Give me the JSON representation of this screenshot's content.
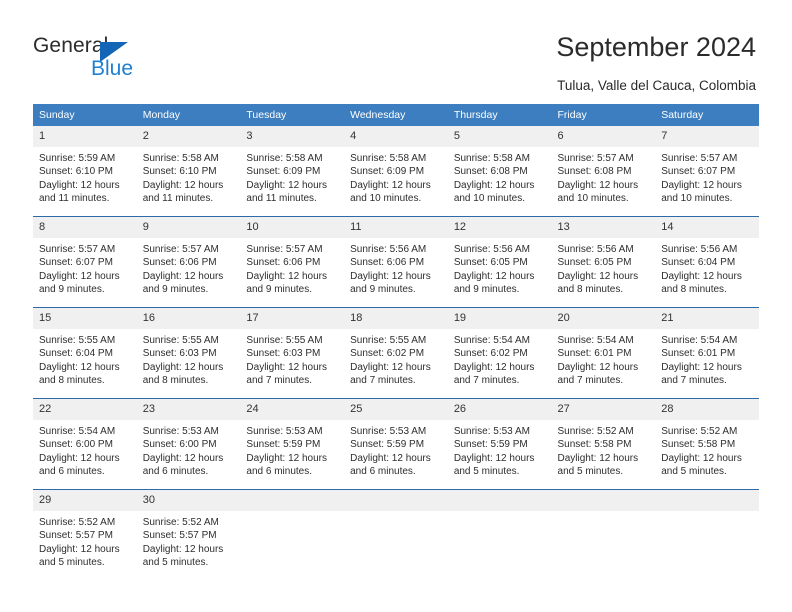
{
  "brand": {
    "name_top": "General",
    "name_bottom": "Blue",
    "accent_color": "#1f7fd0",
    "triangle_color": "#1266b5"
  },
  "header": {
    "title": "September 2024",
    "subtitle": "Tulua, Valle del Cauca, Colombia"
  },
  "calendar": {
    "header_bg": "#3c7ebf",
    "row_border_color": "#2c6ba5",
    "daynum_bg": "#f0f0f0",
    "weekdays": [
      "Sunday",
      "Monday",
      "Tuesday",
      "Wednesday",
      "Thursday",
      "Friday",
      "Saturday"
    ],
    "weeks": [
      [
        {
          "day": "1",
          "sunrise": "Sunrise: 5:59 AM",
          "sunset": "Sunset: 6:10 PM",
          "daylight1": "Daylight: 12 hours",
          "daylight2": "and 11 minutes."
        },
        {
          "day": "2",
          "sunrise": "Sunrise: 5:58 AM",
          "sunset": "Sunset: 6:10 PM",
          "daylight1": "Daylight: 12 hours",
          "daylight2": "and 11 minutes."
        },
        {
          "day": "3",
          "sunrise": "Sunrise: 5:58 AM",
          "sunset": "Sunset: 6:09 PM",
          "daylight1": "Daylight: 12 hours",
          "daylight2": "and 11 minutes."
        },
        {
          "day": "4",
          "sunrise": "Sunrise: 5:58 AM",
          "sunset": "Sunset: 6:09 PM",
          "daylight1": "Daylight: 12 hours",
          "daylight2": "and 10 minutes."
        },
        {
          "day": "5",
          "sunrise": "Sunrise: 5:58 AM",
          "sunset": "Sunset: 6:08 PM",
          "daylight1": "Daylight: 12 hours",
          "daylight2": "and 10 minutes."
        },
        {
          "day": "6",
          "sunrise": "Sunrise: 5:57 AM",
          "sunset": "Sunset: 6:08 PM",
          "daylight1": "Daylight: 12 hours",
          "daylight2": "and 10 minutes."
        },
        {
          "day": "7",
          "sunrise": "Sunrise: 5:57 AM",
          "sunset": "Sunset: 6:07 PM",
          "daylight1": "Daylight: 12 hours",
          "daylight2": "and 10 minutes."
        }
      ],
      [
        {
          "day": "8",
          "sunrise": "Sunrise: 5:57 AM",
          "sunset": "Sunset: 6:07 PM",
          "daylight1": "Daylight: 12 hours",
          "daylight2": "and 9 minutes."
        },
        {
          "day": "9",
          "sunrise": "Sunrise: 5:57 AM",
          "sunset": "Sunset: 6:06 PM",
          "daylight1": "Daylight: 12 hours",
          "daylight2": "and 9 minutes."
        },
        {
          "day": "10",
          "sunrise": "Sunrise: 5:57 AM",
          "sunset": "Sunset: 6:06 PM",
          "daylight1": "Daylight: 12 hours",
          "daylight2": "and 9 minutes."
        },
        {
          "day": "11",
          "sunrise": "Sunrise: 5:56 AM",
          "sunset": "Sunset: 6:06 PM",
          "daylight1": "Daylight: 12 hours",
          "daylight2": "and 9 minutes."
        },
        {
          "day": "12",
          "sunrise": "Sunrise: 5:56 AM",
          "sunset": "Sunset: 6:05 PM",
          "daylight1": "Daylight: 12 hours",
          "daylight2": "and 9 minutes."
        },
        {
          "day": "13",
          "sunrise": "Sunrise: 5:56 AM",
          "sunset": "Sunset: 6:05 PM",
          "daylight1": "Daylight: 12 hours",
          "daylight2": "and 8 minutes."
        },
        {
          "day": "14",
          "sunrise": "Sunrise: 5:56 AM",
          "sunset": "Sunset: 6:04 PM",
          "daylight1": "Daylight: 12 hours",
          "daylight2": "and 8 minutes."
        }
      ],
      [
        {
          "day": "15",
          "sunrise": "Sunrise: 5:55 AM",
          "sunset": "Sunset: 6:04 PM",
          "daylight1": "Daylight: 12 hours",
          "daylight2": "and 8 minutes."
        },
        {
          "day": "16",
          "sunrise": "Sunrise: 5:55 AM",
          "sunset": "Sunset: 6:03 PM",
          "daylight1": "Daylight: 12 hours",
          "daylight2": "and 8 minutes."
        },
        {
          "day": "17",
          "sunrise": "Sunrise: 5:55 AM",
          "sunset": "Sunset: 6:03 PM",
          "daylight1": "Daylight: 12 hours",
          "daylight2": "and 7 minutes."
        },
        {
          "day": "18",
          "sunrise": "Sunrise: 5:55 AM",
          "sunset": "Sunset: 6:02 PM",
          "daylight1": "Daylight: 12 hours",
          "daylight2": "and 7 minutes."
        },
        {
          "day": "19",
          "sunrise": "Sunrise: 5:54 AM",
          "sunset": "Sunset: 6:02 PM",
          "daylight1": "Daylight: 12 hours",
          "daylight2": "and 7 minutes."
        },
        {
          "day": "20",
          "sunrise": "Sunrise: 5:54 AM",
          "sunset": "Sunset: 6:01 PM",
          "daylight1": "Daylight: 12 hours",
          "daylight2": "and 7 minutes."
        },
        {
          "day": "21",
          "sunrise": "Sunrise: 5:54 AM",
          "sunset": "Sunset: 6:01 PM",
          "daylight1": "Daylight: 12 hours",
          "daylight2": "and 7 minutes."
        }
      ],
      [
        {
          "day": "22",
          "sunrise": "Sunrise: 5:54 AM",
          "sunset": "Sunset: 6:00 PM",
          "daylight1": "Daylight: 12 hours",
          "daylight2": "and 6 minutes."
        },
        {
          "day": "23",
          "sunrise": "Sunrise: 5:53 AM",
          "sunset": "Sunset: 6:00 PM",
          "daylight1": "Daylight: 12 hours",
          "daylight2": "and 6 minutes."
        },
        {
          "day": "24",
          "sunrise": "Sunrise: 5:53 AM",
          "sunset": "Sunset: 5:59 PM",
          "daylight1": "Daylight: 12 hours",
          "daylight2": "and 6 minutes."
        },
        {
          "day": "25",
          "sunrise": "Sunrise: 5:53 AM",
          "sunset": "Sunset: 5:59 PM",
          "daylight1": "Daylight: 12 hours",
          "daylight2": "and 6 minutes."
        },
        {
          "day": "26",
          "sunrise": "Sunrise: 5:53 AM",
          "sunset": "Sunset: 5:59 PM",
          "daylight1": "Daylight: 12 hours",
          "daylight2": "and 5 minutes."
        },
        {
          "day": "27",
          "sunrise": "Sunrise: 5:52 AM",
          "sunset": "Sunset: 5:58 PM",
          "daylight1": "Daylight: 12 hours",
          "daylight2": "and 5 minutes."
        },
        {
          "day": "28",
          "sunrise": "Sunrise: 5:52 AM",
          "sunset": "Sunset: 5:58 PM",
          "daylight1": "Daylight: 12 hours",
          "daylight2": "and 5 minutes."
        }
      ],
      [
        {
          "day": "29",
          "sunrise": "Sunrise: 5:52 AM",
          "sunset": "Sunset: 5:57 PM",
          "daylight1": "Daylight: 12 hours",
          "daylight2": "and 5 minutes."
        },
        {
          "day": "30",
          "sunrise": "Sunrise: 5:52 AM",
          "sunset": "Sunset: 5:57 PM",
          "daylight1": "Daylight: 12 hours",
          "daylight2": "and 5 minutes."
        },
        {
          "day": "",
          "sunrise": "",
          "sunset": "",
          "daylight1": "",
          "daylight2": ""
        },
        {
          "day": "",
          "sunrise": "",
          "sunset": "",
          "daylight1": "",
          "daylight2": ""
        },
        {
          "day": "",
          "sunrise": "",
          "sunset": "",
          "daylight1": "",
          "daylight2": ""
        },
        {
          "day": "",
          "sunrise": "",
          "sunset": "",
          "daylight1": "",
          "daylight2": ""
        },
        {
          "day": "",
          "sunrise": "",
          "sunset": "",
          "daylight1": "",
          "daylight2": ""
        }
      ]
    ]
  }
}
